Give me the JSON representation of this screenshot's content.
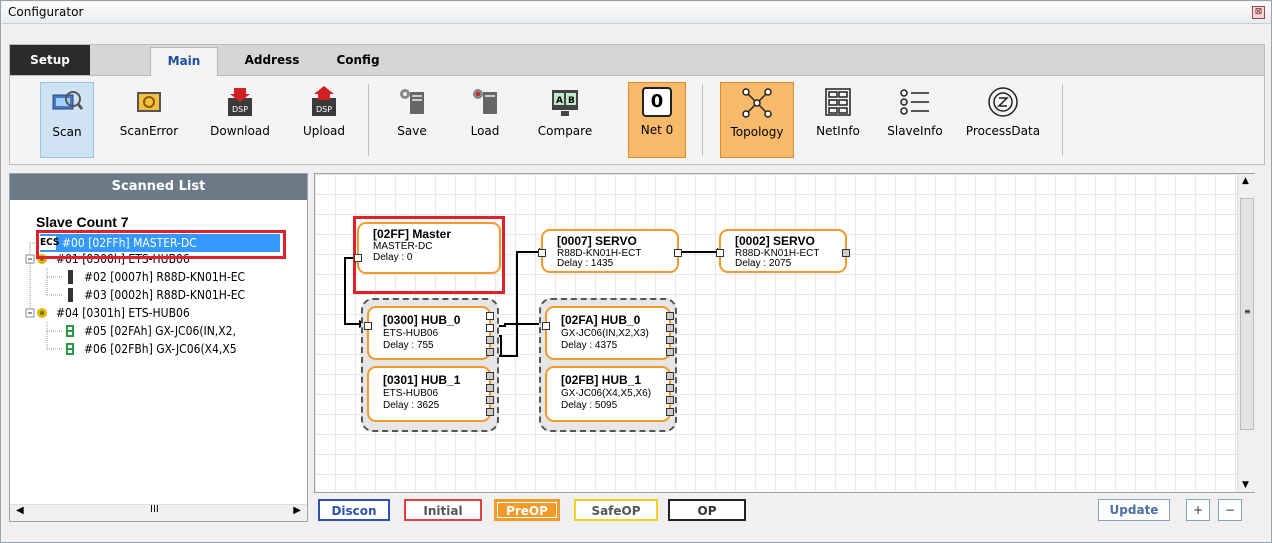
{
  "window": {
    "title": "Configurator"
  },
  "tabs": {
    "setup": "Setup",
    "main": "Main",
    "address": "Address",
    "config": "Config"
  },
  "toolbar": {
    "scan": "Scan",
    "scan_error": "ScanError",
    "download": "Download",
    "upload": "Upload",
    "save": "Save",
    "load": "Load",
    "compare": "Compare",
    "net_label": "Net 0",
    "net_value": "0",
    "topology": "Topology",
    "netinfo": "NetInfo",
    "slaveinfo": "SlaveInfo",
    "processdata": "ProcessData",
    "dsp": "DSP"
  },
  "scanned_list": {
    "header": "Scanned List",
    "slave_count": "Slave Count  7",
    "items": [
      {
        "label": "#00  [02FFh] MASTER-DC",
        "icon": "ecs-master-icon"
      },
      {
        "label": "#01  [0300h] ETS-HUB06",
        "icon": "hub-icon"
      },
      {
        "label": "#02  [0007h] R88D-KN01H-EC",
        "icon": "servo-icon"
      },
      {
        "label": "#03  [0002h] R88D-KN01H-EC",
        "icon": "servo-icon"
      },
      {
        "label": "#04  [0301h] ETS-HUB06",
        "icon": "hub-icon"
      },
      {
        "label": "#05  [02FAh] GX-JC06(IN,X2,",
        "icon": "junction-icon"
      },
      {
        "label": "#06  [02FBh] GX-JC06(X4,X5",
        "icon": "junction-icon"
      }
    ],
    "ecs_text": "ECS"
  },
  "topology": {
    "nodes": [
      {
        "title": "[02FF] Master",
        "model": "MASTER-DC",
        "delay": "Delay : 0"
      },
      {
        "title": "[0007] SERVO",
        "model": "R88D-KN01H-ECT",
        "delay": "Delay : 1435"
      },
      {
        "title": "[0002] SERVO",
        "model": "R88D-KN01H-ECT",
        "delay": "Delay : 2075"
      },
      {
        "title": "[0300] HUB_0",
        "model": "ETS-HUB06",
        "delay": "Delay : 755"
      },
      {
        "title": "[0301] HUB_1",
        "model": "ETS-HUB06",
        "delay": "Delay : 3625"
      },
      {
        "title": "[02FA] HUB_0",
        "model": "GX-JC06(IN,X2,X3)",
        "delay": "Delay : 4375"
      },
      {
        "title": "[02FB] HUB_1",
        "model": "GX-JC06(X4,X5,X6)",
        "delay": "Delay : 5095"
      }
    ]
  },
  "status": {
    "discon": "Discon",
    "initial": "Initial",
    "preop": "PreOP",
    "safeop": "SafeOP",
    "op": "OP",
    "update": "Update",
    "plus": "+",
    "minus": "−"
  },
  "colors": {
    "accent_orange": "#f39a2b",
    "highlight_red": "#e0202a",
    "select_blue": "#3399ff"
  }
}
